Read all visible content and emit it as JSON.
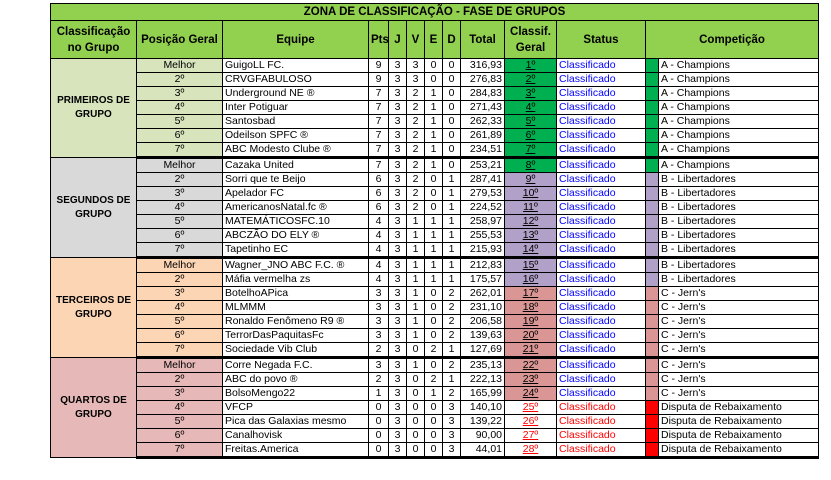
{
  "title": "ZONA DE CLASSIFICAÇÃO - FASE DE GRUPOS",
  "headers": {
    "grupo": "Classificação no Grupo",
    "geral": "Posição Geral",
    "equipe": "Equipe",
    "pts": "Pts",
    "j": "J",
    "v": "V",
    "e": "E",
    "d": "D",
    "total": "Total",
    "classif": "Classif. Geral",
    "status": "Status",
    "competicao": "Competição"
  },
  "colors": {
    "header_green": "#92d050",
    "champions_green": "#00b050",
    "libertadores_purple": "#b1a0c7",
    "jerns_pink": "#da9694",
    "rebaixamento_red": "#ff0000",
    "status_blue": "#0000ff"
  },
  "groups": [
    {
      "label": "PRIMEIROS DE GRUPO",
      "rows": [
        {
          "pos": "Melhor",
          "team": "GuigoLL FC.",
          "pts": "9",
          "j": "3",
          "v": "3",
          "e": "0",
          "d": "0",
          "total": "316,93",
          "classif": "1º",
          "status": "Classificado",
          "comp": "A - Champions"
        },
        {
          "pos": "2º",
          "team": "CRVGFABULOSO",
          "pts": "9",
          "j": "3",
          "v": "3",
          "e": "0",
          "d": "0",
          "total": "276,83",
          "classif": "2º",
          "status": "Classificado",
          "comp": "A - Champions"
        },
        {
          "pos": "3º",
          "team": "Underground NE ®",
          "pts": "7",
          "j": "3",
          "v": "2",
          "e": "1",
          "d": "0",
          "total": "284,83",
          "classif": "3º",
          "status": "Classificado",
          "comp": "A - Champions"
        },
        {
          "pos": "4º",
          "team": "Inter Potiguar",
          "pts": "7",
          "j": "3",
          "v": "2",
          "e": "1",
          "d": "0",
          "total": "271,43",
          "classif": "4º",
          "status": "Classificado",
          "comp": "A - Champions"
        },
        {
          "pos": "5º",
          "team": "Santosbad",
          "pts": "7",
          "j": "3",
          "v": "2",
          "e": "1",
          "d": "0",
          "total": "262,33",
          "classif": "5º",
          "status": "Classificado",
          "comp": "A - Champions"
        },
        {
          "pos": "6º",
          "team": "Odeilson SPFC ®",
          "pts": "7",
          "j": "3",
          "v": "2",
          "e": "1",
          "d": "0",
          "total": "261,89",
          "classif": "6º",
          "status": "Classificado",
          "comp": "A - Champions"
        },
        {
          "pos": "7º",
          "team": "ABC Modesto Clube ®",
          "pts": "7",
          "j": "3",
          "v": "2",
          "e": "1",
          "d": "0",
          "total": "234,51",
          "classif": "7º",
          "status": "Classificado",
          "comp": "A - Champions"
        }
      ]
    },
    {
      "label": "SEGUNDOS DE GRUPO",
      "rows": [
        {
          "pos": "Melhor",
          "team": "Cazaka United",
          "pts": "7",
          "j": "3",
          "v": "2",
          "e": "1",
          "d": "0",
          "total": "253,21",
          "classif": "8º",
          "status": "Classificado",
          "comp": "A - Champions"
        },
        {
          "pos": "2º",
          "team": "Sorri que te Beijo",
          "pts": "6",
          "j": "3",
          "v": "2",
          "e": "0",
          "d": "1",
          "total": "287,41",
          "classif": "9º",
          "status": "Classificado",
          "comp": "B - Libertadores"
        },
        {
          "pos": "3º",
          "team": "Apelador FC",
          "pts": "6",
          "j": "3",
          "v": "2",
          "e": "0",
          "d": "1",
          "total": "279,53",
          "classif": "10º",
          "status": "Classificado",
          "comp": "B - Libertadores"
        },
        {
          "pos": "4º",
          "team": "AmericanosNatal.fc ®",
          "pts": "6",
          "j": "3",
          "v": "2",
          "e": "0",
          "d": "1",
          "total": "224,52",
          "classif": "11º",
          "status": "Classificado",
          "comp": "B - Libertadores"
        },
        {
          "pos": "5º",
          "team": "MATEMÁTICOSFC.10",
          "pts": "4",
          "j": "3",
          "v": "1",
          "e": "1",
          "d": "1",
          "total": "258,97",
          "classif": "12º",
          "status": "Classificado",
          "comp": "B - Libertadores"
        },
        {
          "pos": "6º",
          "team": "ABCZÃO DO ELY ®",
          "pts": "4",
          "j": "3",
          "v": "1",
          "e": "1",
          "d": "1",
          "total": "255,53",
          "classif": "13º",
          "status": "Classificado",
          "comp": "B - Libertadores"
        },
        {
          "pos": "7º",
          "team": "Tapetinho EC",
          "pts": "4",
          "j": "3",
          "v": "1",
          "e": "1",
          "d": "1",
          "total": "215,93",
          "classif": "14º",
          "status": "Classificado",
          "comp": "B - Libertadores"
        }
      ]
    },
    {
      "label": "TERCEIROS DE GRUPO",
      "rows": [
        {
          "pos": "Melhor",
          "team": "Wagner_JNO ABC F.C. ®",
          "pts": "4",
          "j": "3",
          "v": "1",
          "e": "1",
          "d": "1",
          "total": "212,83",
          "classif": "15º",
          "status": "Classificado",
          "comp": "B - Libertadores"
        },
        {
          "pos": "2º",
          "team": "Máfia vermelha zs",
          "pts": "4",
          "j": "3",
          "v": "1",
          "e": "1",
          "d": "1",
          "total": "175,57",
          "classif": "16º",
          "status": "Classificado",
          "comp": "B - Libertadores"
        },
        {
          "pos": "3º",
          "team": "BotelhoAPica",
          "pts": "3",
          "j": "3",
          "v": "1",
          "e": "0",
          "d": "2",
          "total": "262,01",
          "classif": "17º",
          "status": "Classificado",
          "comp": "C - Jern's"
        },
        {
          "pos": "4º",
          "team": "MLMMM",
          "pts": "3",
          "j": "3",
          "v": "1",
          "e": "0",
          "d": "2",
          "total": "231,10",
          "classif": "18º",
          "status": "Classificado",
          "comp": "C - Jern's"
        },
        {
          "pos": "5º",
          "team": "Ronaldo Fenômeno R9 ®",
          "pts": "3",
          "j": "3",
          "v": "1",
          "e": "0",
          "d": "2",
          "total": "206,58",
          "classif": "19º",
          "status": "Classificado",
          "comp": "C - Jern's"
        },
        {
          "pos": "6º",
          "team": "TerrorDasPaquitasFc",
          "pts": "3",
          "j": "3",
          "v": "1",
          "e": "0",
          "d": "2",
          "total": "139,63",
          "classif": "20º",
          "status": "Classificado",
          "comp": "C - Jern's"
        },
        {
          "pos": "7º",
          "team": "Sociedade Vib Club",
          "pts": "2",
          "j": "3",
          "v": "0",
          "e": "2",
          "d": "1",
          "total": "127,69",
          "classif": "21º",
          "status": "Classificado",
          "comp": "C - Jern's"
        }
      ]
    },
    {
      "label": "QUARTOS DE GRUPO",
      "rows": [
        {
          "pos": "Melhor",
          "team": "Corre Negada F.C.",
          "pts": "3",
          "j": "3",
          "v": "1",
          "e": "0",
          "d": "2",
          "total": "235,13",
          "classif": "22º",
          "status": "Classificado",
          "comp": "C - Jern's"
        },
        {
          "pos": "2º",
          "team": "ABC do povo ®",
          "pts": "2",
          "j": "3",
          "v": "0",
          "e": "2",
          "d": "1",
          "total": "222,13",
          "classif": "23º",
          "status": "Classificado",
          "comp": "C - Jern's"
        },
        {
          "pos": "3º",
          "team": "BolsoMengo22",
          "pts": "1",
          "j": "3",
          "v": "0",
          "e": "1",
          "d": "2",
          "total": "165,99",
          "classif": "24º",
          "status": "Classificado",
          "comp": "C - Jern's"
        },
        {
          "pos": "4º",
          "team": "VFCP",
          "pts": "0",
          "j": "3",
          "v": "0",
          "e": "0",
          "d": "3",
          "total": "140,10",
          "classif": "25º",
          "status": "Classificado",
          "comp": "Disputa de Rebaixamento"
        },
        {
          "pos": "5º",
          "team": "Pica das Galaxias mesmo",
          "pts": "0",
          "j": "3",
          "v": "0",
          "e": "0",
          "d": "3",
          "total": "139,22",
          "classif": "26º",
          "status": "Classificado",
          "comp": "Disputa de Rebaixamento"
        },
        {
          "pos": "6º",
          "team": "Canalhovisk",
          "pts": "0",
          "j": "3",
          "v": "0",
          "e": "0",
          "d": "3",
          "total": "90,00",
          "classif": "27º",
          "status": "Classificado",
          "comp": "Disputa de Rebaixamento"
        },
        {
          "pos": "7º",
          "team": "Freitas.America",
          "pts": "0",
          "j": "3",
          "v": "0",
          "e": "0",
          "d": "3",
          "total": "44,01",
          "classif": "28º",
          "status": "Classificado",
          "comp": "Disputa de Rebaixamento"
        }
      ]
    }
  ]
}
